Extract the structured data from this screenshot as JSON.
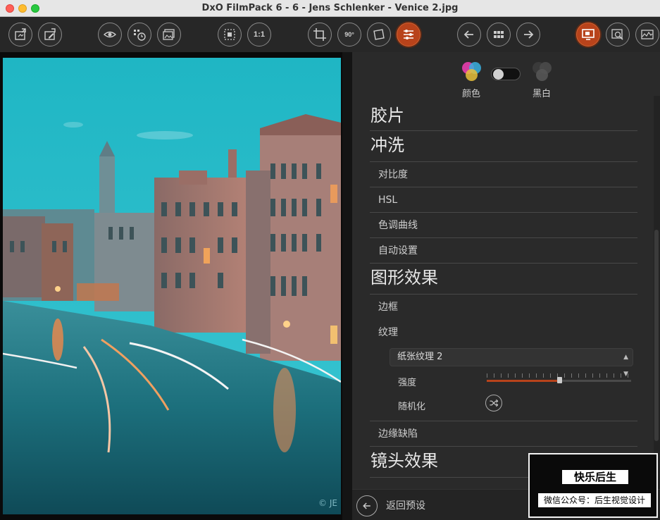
{
  "window": {
    "title": "DxO FilmPack 6 - 6 - Jens Schlenker - Venice 2.jpg"
  },
  "toolbar": {
    "buttons": [
      {
        "name": "export-icon",
        "active": false
      },
      {
        "name": "edit-export-icon",
        "active": false
      },
      {
        "name": "eye-icon",
        "active": false
      },
      {
        "name": "grid-clock-icon",
        "active": false
      },
      {
        "name": "images-icon",
        "active": false
      },
      {
        "name": "fit-icon",
        "active": false
      },
      {
        "name": "zoom-100",
        "label": "1:1",
        "active": false
      },
      {
        "name": "crop-icon",
        "active": false
      },
      {
        "name": "rotate-90-icon",
        "label": "90°",
        "active": false
      },
      {
        "name": "straighten-icon",
        "active": false
      },
      {
        "name": "sliders-icon",
        "active": true
      },
      {
        "name": "prev-icon",
        "active": false
      },
      {
        "name": "grid-icon",
        "active": false
      },
      {
        "name": "next-icon",
        "active": false
      },
      {
        "name": "display-icon",
        "active": true
      },
      {
        "name": "compare-icon",
        "active": false
      },
      {
        "name": "histogram-icon",
        "active": false
      }
    ],
    "zoom_label": "1:1",
    "rotate_label": "90°"
  },
  "photo": {
    "watermark": "© JE"
  },
  "panel": {
    "mode": {
      "color_label": "颜色",
      "bw_label": "黑白",
      "toggle_on": false
    },
    "sections": {
      "film": "胶片",
      "develop": "冲洗",
      "contrast": "对比度",
      "hsl": "HSL",
      "tone_curve": "色调曲线",
      "auto_settings": "自动设置",
      "graphic_effects": "图形效果",
      "frame": "边框",
      "texture": "纹理",
      "texture_select": "纸张纹理 2",
      "intensity": "强度",
      "intensity_value": 0.5,
      "randomize": "随机化",
      "edge_defects": "边缘缺陷",
      "lens_effects": "镜头效果"
    },
    "footer": {
      "back_label": "返回预设"
    }
  },
  "watermark": {
    "line1": "快乐后生",
    "line2": "微信公众号：后生视觉设计"
  },
  "colors": {
    "accent": "#b8431b",
    "panel": "#2a2a2a",
    "sky": "#2ab7c8"
  }
}
